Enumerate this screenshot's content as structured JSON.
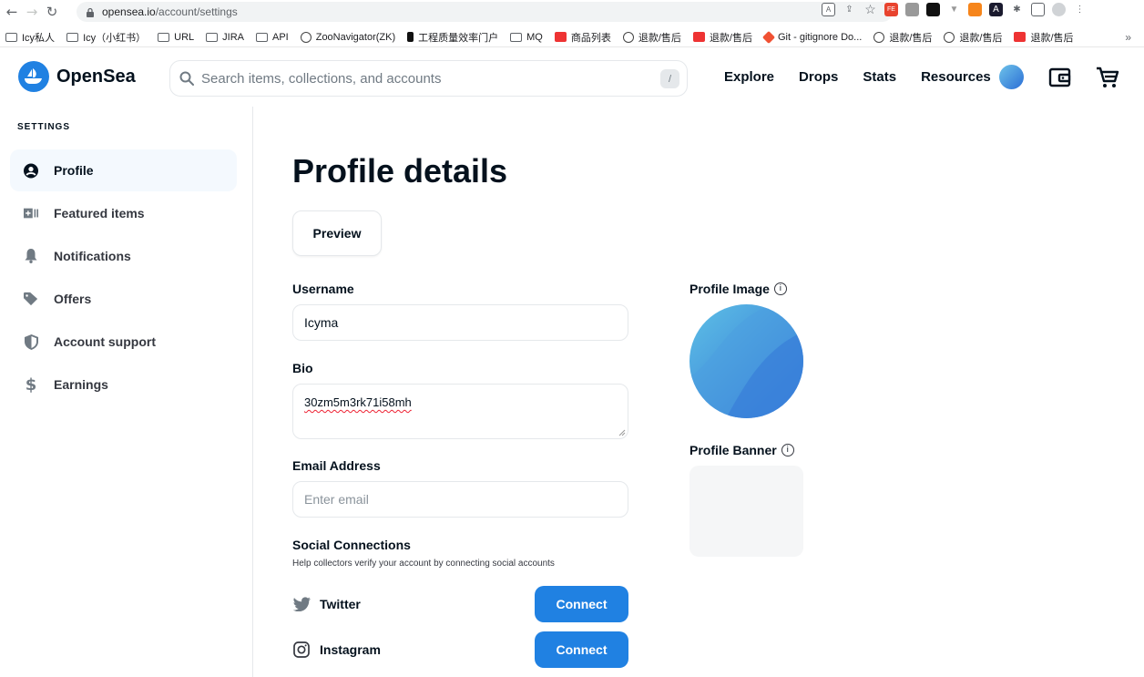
{
  "browser": {
    "url_host": "opensea.io",
    "url_path": "/account/settings",
    "bookmarks": [
      "Icy私人",
      "Icy（小红书）",
      "URL",
      "JIRA",
      "API",
      "ZooNavigator(ZK)",
      "工程质量效率门户",
      "MQ",
      "商品列表",
      "退款/售后",
      "退款/售后",
      "Git - gitignore Do...",
      "退款/售后",
      "退款/售后",
      "退款/售后"
    ],
    "overflow": "»"
  },
  "header": {
    "brand": "OpenSea",
    "search_placeholder": "Search items, collections, and accounts",
    "search_shortcut": "/",
    "nav": [
      "Explore",
      "Drops",
      "Stats",
      "Resources"
    ]
  },
  "sidebar": {
    "title": "SETTINGS",
    "items": [
      {
        "label": "Profile",
        "icon": "user-circle-icon",
        "active": true
      },
      {
        "label": "Featured items",
        "icon": "featured-icon",
        "active": false
      },
      {
        "label": "Notifications",
        "icon": "bell-icon",
        "active": false
      },
      {
        "label": "Offers",
        "icon": "tag-icon",
        "active": false
      },
      {
        "label": "Account support",
        "icon": "shield-icon",
        "active": false
      },
      {
        "label": "Earnings",
        "icon": "dollar-icon",
        "active": false
      }
    ]
  },
  "main": {
    "title": "Profile details",
    "preview_label": "Preview",
    "username_label": "Username",
    "username_value": "Icyma",
    "bio_label": "Bio",
    "bio_value": "30zm5m3rk71i58mh",
    "email_label": "Email Address",
    "email_placeholder": "Enter email",
    "social_title": "Social Connections",
    "social_help": "Help collectors verify your account by connecting social accounts",
    "socials": [
      {
        "name": "Twitter",
        "icon": "twitter-icon",
        "button": "Connect"
      },
      {
        "name": "Instagram",
        "icon": "instagram-icon",
        "button": "Connect"
      }
    ]
  },
  "right": {
    "profile_image_label": "Profile Image",
    "profile_banner_label": "Profile Banner"
  },
  "colors": {
    "accent": "#2081e2",
    "active_bg": "#f4f9fe",
    "border": "#e5e8eb"
  }
}
